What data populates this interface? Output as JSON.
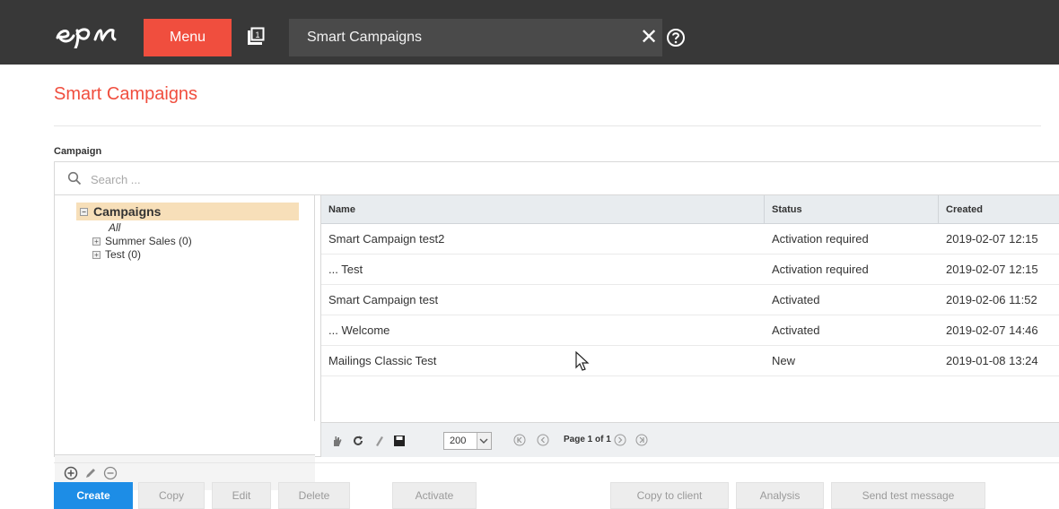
{
  "topbar": {
    "menu_label": "Menu",
    "tab_title": "Smart Campaigns",
    "close_glyph": "✕"
  },
  "page": {
    "title": "Smart Campaigns",
    "campaign_label": "Campaign"
  },
  "search": {
    "placeholder": "Search ..."
  },
  "tree": {
    "root_label": "Campaigns",
    "all_label": "All",
    "items": [
      {
        "label": "Summer Sales (0)"
      },
      {
        "label": "Test (0)"
      }
    ]
  },
  "grid": {
    "columns": [
      "Name",
      "Status",
      "Created"
    ],
    "rows": [
      {
        "name": "Smart Campaign test2",
        "status": "Activation required",
        "created": "2019-02-07 12:15"
      },
      {
        "name": "... Test",
        "status": "Activation required",
        "created": "2019-02-07 12:15"
      },
      {
        "name": "Smart Campaign test",
        "status": "Activated",
        "created": "2019-02-06 11:52"
      },
      {
        "name": "... Welcome",
        "status": "Activated",
        "created": "2019-02-07 14:46"
      },
      {
        "name": "Mailings Classic Test",
        "status": "New",
        "created": "2019-01-08 13:24"
      }
    ],
    "page_size": "200",
    "pager_text": "Page 1 of 1"
  },
  "actions": {
    "create": "Create",
    "copy": "Copy",
    "edit": "Edit",
    "delete": "Delete",
    "activate": "Activate",
    "copy_to_client": "Copy to client",
    "analysis": "Analysis",
    "send_test_message": "Send test message"
  },
  "colors": {
    "brand": "#f04e3e",
    "topbar": "#383838",
    "primary_button": "#1d8de6",
    "tree_selected": "#f7dfb9"
  }
}
